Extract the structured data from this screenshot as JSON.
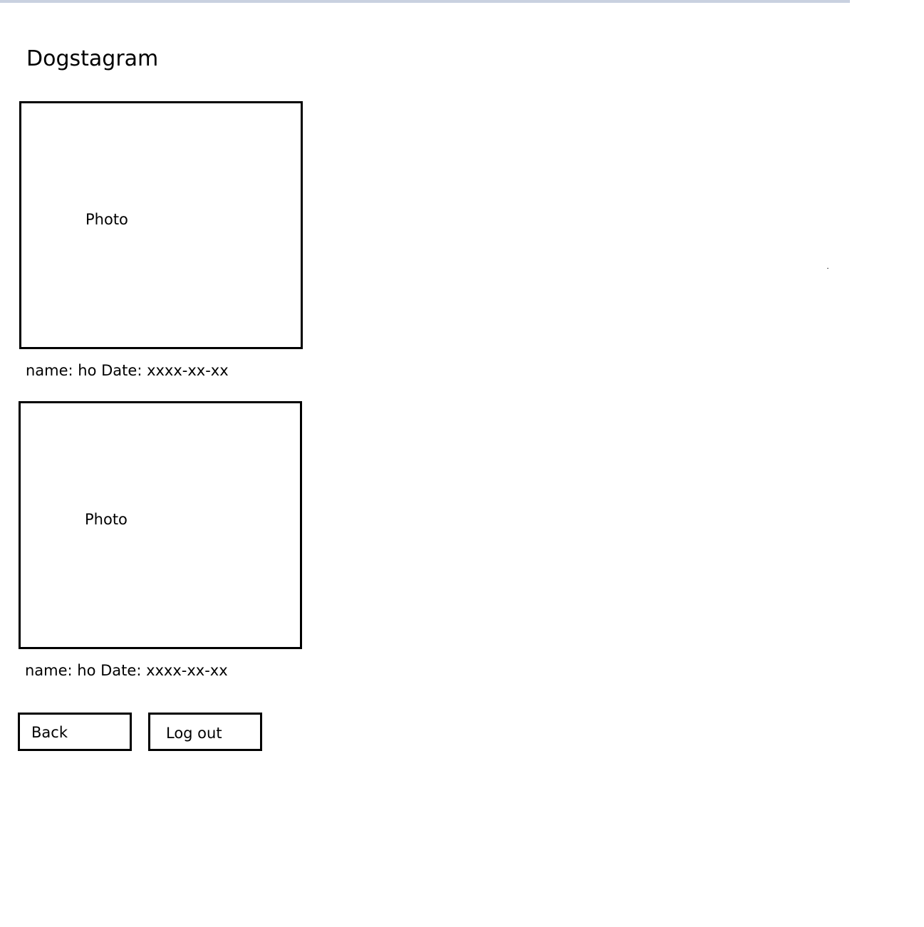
{
  "app": {
    "title": "Dogstagram"
  },
  "posts": [
    {
      "photo_label": "Photo",
      "caption": "name: ho Date: xxxx-xx-xx"
    },
    {
      "photo_label": "Photo",
      "caption": "name: ho Date: xxxx-xx-xx"
    }
  ],
  "actions": {
    "back_label": "Back",
    "logout_label": "Log out"
  },
  "colors": {
    "top_bar": "#c9d1e0",
    "border": "#000000",
    "background": "#ffffff"
  }
}
